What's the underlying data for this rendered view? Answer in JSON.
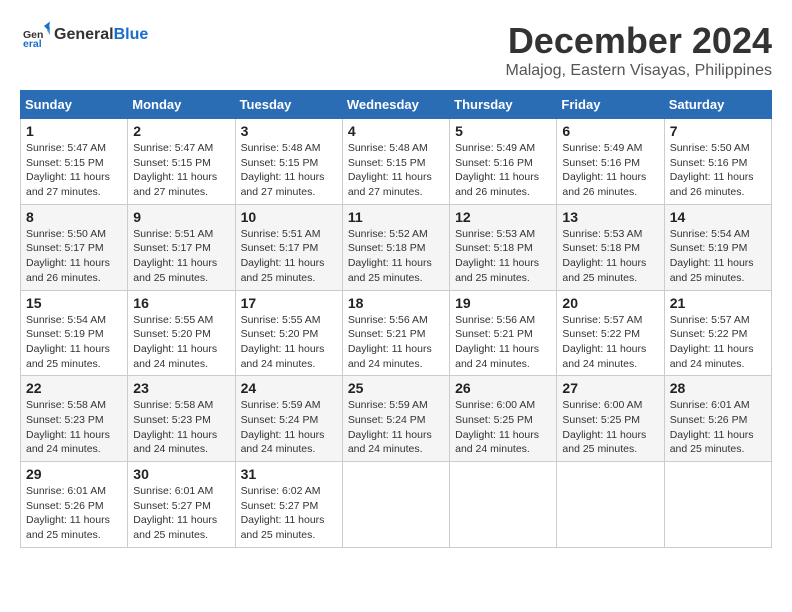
{
  "header": {
    "logo_general": "General",
    "logo_blue": "Blue",
    "title": "December 2024",
    "subtitle": "Malajog, Eastern Visayas, Philippines"
  },
  "calendar": {
    "days_of_week": [
      "Sunday",
      "Monday",
      "Tuesday",
      "Wednesday",
      "Thursday",
      "Friday",
      "Saturday"
    ],
    "weeks": [
      [
        {
          "day": "1",
          "info": "Sunrise: 5:47 AM\nSunset: 5:15 PM\nDaylight: 11 hours\nand 27 minutes."
        },
        {
          "day": "2",
          "info": "Sunrise: 5:47 AM\nSunset: 5:15 PM\nDaylight: 11 hours\nand 27 minutes."
        },
        {
          "day": "3",
          "info": "Sunrise: 5:48 AM\nSunset: 5:15 PM\nDaylight: 11 hours\nand 27 minutes."
        },
        {
          "day": "4",
          "info": "Sunrise: 5:48 AM\nSunset: 5:15 PM\nDaylight: 11 hours\nand 27 minutes."
        },
        {
          "day": "5",
          "info": "Sunrise: 5:49 AM\nSunset: 5:16 PM\nDaylight: 11 hours\nand 26 minutes."
        },
        {
          "day": "6",
          "info": "Sunrise: 5:49 AM\nSunset: 5:16 PM\nDaylight: 11 hours\nand 26 minutes."
        },
        {
          "day": "7",
          "info": "Sunrise: 5:50 AM\nSunset: 5:16 PM\nDaylight: 11 hours\nand 26 minutes."
        }
      ],
      [
        {
          "day": "8",
          "info": "Sunrise: 5:50 AM\nSunset: 5:17 PM\nDaylight: 11 hours\nand 26 minutes."
        },
        {
          "day": "9",
          "info": "Sunrise: 5:51 AM\nSunset: 5:17 PM\nDaylight: 11 hours\nand 25 minutes."
        },
        {
          "day": "10",
          "info": "Sunrise: 5:51 AM\nSunset: 5:17 PM\nDaylight: 11 hours\nand 25 minutes."
        },
        {
          "day": "11",
          "info": "Sunrise: 5:52 AM\nSunset: 5:18 PM\nDaylight: 11 hours\nand 25 minutes."
        },
        {
          "day": "12",
          "info": "Sunrise: 5:53 AM\nSunset: 5:18 PM\nDaylight: 11 hours\nand 25 minutes."
        },
        {
          "day": "13",
          "info": "Sunrise: 5:53 AM\nSunset: 5:18 PM\nDaylight: 11 hours\nand 25 minutes."
        },
        {
          "day": "14",
          "info": "Sunrise: 5:54 AM\nSunset: 5:19 PM\nDaylight: 11 hours\nand 25 minutes."
        }
      ],
      [
        {
          "day": "15",
          "info": "Sunrise: 5:54 AM\nSunset: 5:19 PM\nDaylight: 11 hours\nand 25 minutes."
        },
        {
          "day": "16",
          "info": "Sunrise: 5:55 AM\nSunset: 5:20 PM\nDaylight: 11 hours\nand 24 minutes."
        },
        {
          "day": "17",
          "info": "Sunrise: 5:55 AM\nSunset: 5:20 PM\nDaylight: 11 hours\nand 24 minutes."
        },
        {
          "day": "18",
          "info": "Sunrise: 5:56 AM\nSunset: 5:21 PM\nDaylight: 11 hours\nand 24 minutes."
        },
        {
          "day": "19",
          "info": "Sunrise: 5:56 AM\nSunset: 5:21 PM\nDaylight: 11 hours\nand 24 minutes."
        },
        {
          "day": "20",
          "info": "Sunrise: 5:57 AM\nSunset: 5:22 PM\nDaylight: 11 hours\nand 24 minutes."
        },
        {
          "day": "21",
          "info": "Sunrise: 5:57 AM\nSunset: 5:22 PM\nDaylight: 11 hours\nand 24 minutes."
        }
      ],
      [
        {
          "day": "22",
          "info": "Sunrise: 5:58 AM\nSunset: 5:23 PM\nDaylight: 11 hours\nand 24 minutes."
        },
        {
          "day": "23",
          "info": "Sunrise: 5:58 AM\nSunset: 5:23 PM\nDaylight: 11 hours\nand 24 minutes."
        },
        {
          "day": "24",
          "info": "Sunrise: 5:59 AM\nSunset: 5:24 PM\nDaylight: 11 hours\nand 24 minutes."
        },
        {
          "day": "25",
          "info": "Sunrise: 5:59 AM\nSunset: 5:24 PM\nDaylight: 11 hours\nand 24 minutes."
        },
        {
          "day": "26",
          "info": "Sunrise: 6:00 AM\nSunset: 5:25 PM\nDaylight: 11 hours\nand 24 minutes."
        },
        {
          "day": "27",
          "info": "Sunrise: 6:00 AM\nSunset: 5:25 PM\nDaylight: 11 hours\nand 25 minutes."
        },
        {
          "day": "28",
          "info": "Sunrise: 6:01 AM\nSunset: 5:26 PM\nDaylight: 11 hours\nand 25 minutes."
        }
      ],
      [
        {
          "day": "29",
          "info": "Sunrise: 6:01 AM\nSunset: 5:26 PM\nDaylight: 11 hours\nand 25 minutes."
        },
        {
          "day": "30",
          "info": "Sunrise: 6:01 AM\nSunset: 5:27 PM\nDaylight: 11 hours\nand 25 minutes."
        },
        {
          "day": "31",
          "info": "Sunrise: 6:02 AM\nSunset: 5:27 PM\nDaylight: 11 hours\nand 25 minutes."
        },
        {
          "day": "",
          "info": ""
        },
        {
          "day": "",
          "info": ""
        },
        {
          "day": "",
          "info": ""
        },
        {
          "day": "",
          "info": ""
        }
      ]
    ]
  }
}
